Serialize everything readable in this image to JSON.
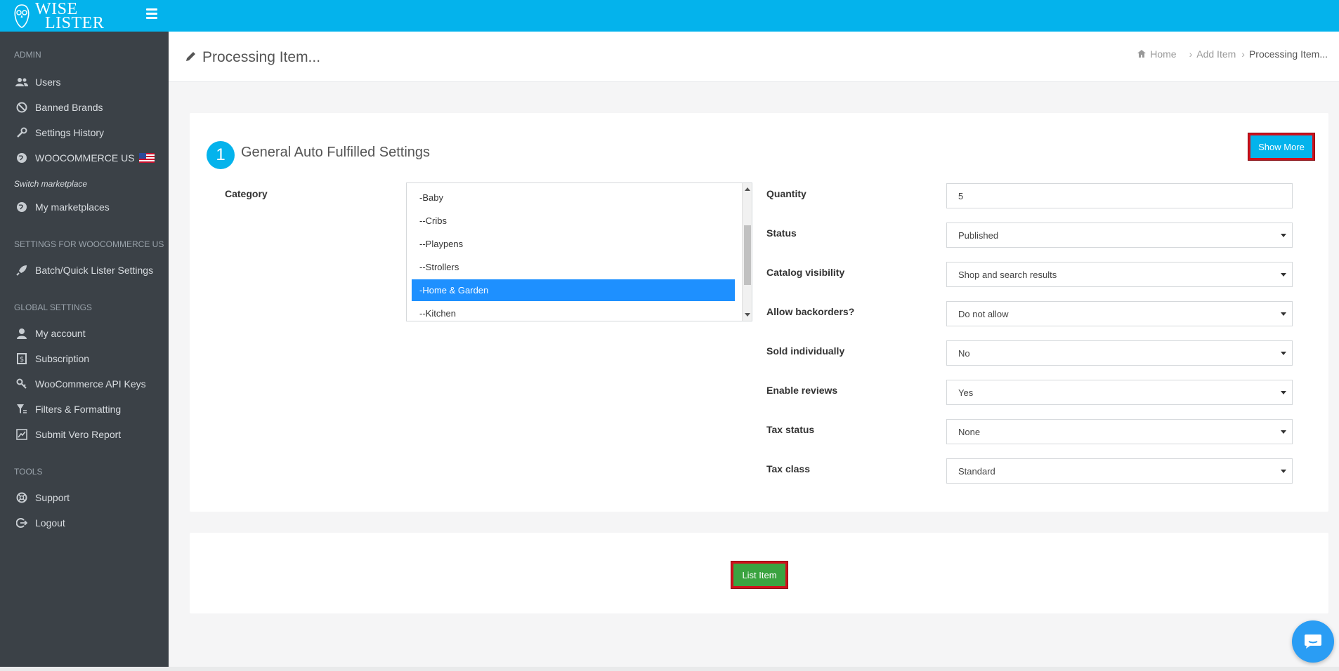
{
  "brand": {
    "line1": "WISE",
    "line2": "LISTER"
  },
  "sidebar": {
    "sections": [
      {
        "title": "ADMIN"
      },
      {
        "title": "SETTINGS FOR WOOCOMMERCE US"
      },
      {
        "title": "GLOBAL SETTINGS"
      },
      {
        "title": "TOOLS"
      }
    ],
    "admin_items": [
      {
        "label": "Users",
        "icon": "users-icon"
      },
      {
        "label": "Banned Brands",
        "icon": "ban-icon"
      },
      {
        "label": "Settings History",
        "icon": "wrench-icon"
      },
      {
        "label": "WOOCOMMERCE US",
        "icon": "globe-icon"
      }
    ],
    "switch_marketplace": "Switch marketplace",
    "my_marketplaces": {
      "label": "My marketplaces",
      "icon": "globe-icon"
    },
    "settings_items": [
      {
        "label": "Batch/Quick Lister Settings",
        "icon": "rocket-icon"
      }
    ],
    "global_items": [
      {
        "label": "My account",
        "icon": "user-icon"
      },
      {
        "label": "Subscription",
        "icon": "money-icon"
      },
      {
        "label": "WooCommerce API Keys",
        "icon": "key-icon"
      },
      {
        "label": "Filters & Formatting",
        "icon": "filter-icon"
      },
      {
        "label": "Submit Vero Report",
        "icon": "report-icon"
      }
    ],
    "tools_items": [
      {
        "label": "Support",
        "icon": "lifebuoy-icon"
      },
      {
        "label": "Logout",
        "icon": "logout-icon"
      }
    ]
  },
  "header": {
    "title": "Processing Item...",
    "breadcrumb": [
      "Home",
      "Add Item",
      "Processing Item..."
    ]
  },
  "card": {
    "step": "1",
    "title": "General Auto Fulfilled Settings",
    "show_more": "Show More",
    "category_label": "Category",
    "category_options": [
      "-Baby",
      "--Cribs",
      "--Playpens",
      "--Strollers",
      "-Home & Garden",
      "--Kitchen"
    ],
    "category_selected": "-Home & Garden",
    "fields": [
      {
        "label": "Quantity",
        "value": "5",
        "type": "input"
      },
      {
        "label": "Status",
        "value": "Published",
        "type": "select"
      },
      {
        "label": "Catalog visibility",
        "value": "Shop and search results",
        "type": "select"
      },
      {
        "label": "Allow backorders?",
        "value": "Do not allow",
        "type": "select"
      },
      {
        "label": "Sold individually",
        "value": "No",
        "type": "select"
      },
      {
        "label": "Enable reviews",
        "value": "Yes",
        "type": "select"
      },
      {
        "label": "Tax status",
        "value": "None",
        "type": "select"
      },
      {
        "label": "Tax class",
        "value": "Standard",
        "type": "select"
      }
    ]
  },
  "actions": {
    "list_item": "List Item"
  },
  "colors": {
    "accent": "#04b3ec",
    "sidebar": "#3b4147",
    "success": "#3aa340",
    "highlight": "#d0101c",
    "selected": "#1e90ff"
  }
}
